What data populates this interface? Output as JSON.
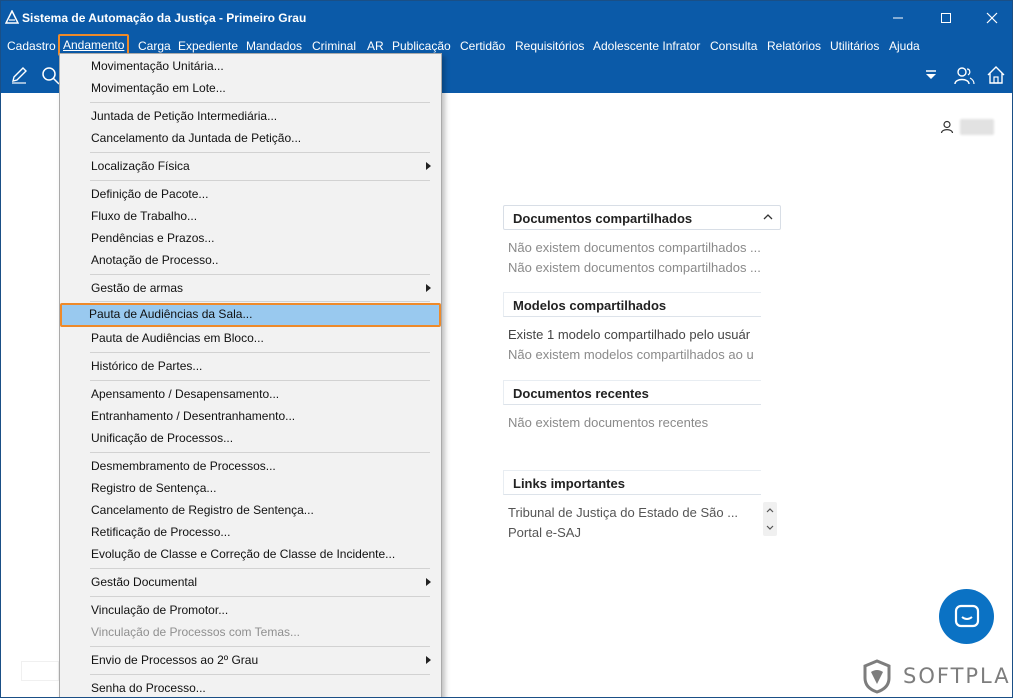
{
  "window": {
    "title": "Sistema de Automação da Justiça - Primeiro Grau"
  },
  "menubar": {
    "items": [
      "Cadastro",
      "Andamento",
      "Carga",
      "Expediente",
      "Mandados",
      "Criminal",
      "AR",
      "Publicação",
      "Certidão",
      "Requisitórios",
      "Adolescente Infrator",
      "Consulta",
      "Relatórios",
      "Utilitários",
      "Ajuda"
    ]
  },
  "dropdown": {
    "items": [
      {
        "label": "Movimentação Unitária..."
      },
      {
        "label": "Movimentação em Lote..."
      },
      {
        "label": "Juntada de Petição Intermediária..."
      },
      {
        "label": "Cancelamento da Juntada de Petição..."
      },
      {
        "label": "Localização Física"
      },
      {
        "label": "Definição de Pacote..."
      },
      {
        "label": "Fluxo de Trabalho..."
      },
      {
        "label": "Pendências e Prazos..."
      },
      {
        "label": "Anotação de Processo.."
      },
      {
        "label": "Gestão de armas"
      },
      {
        "label": "Pauta de Audiências da Sala..."
      },
      {
        "label": "Pauta de Audiências em Bloco..."
      },
      {
        "label": "Histórico de Partes..."
      },
      {
        "label": "Apensamento / Desapensamento..."
      },
      {
        "label": "Entranhamento / Desentranhamento..."
      },
      {
        "label": "Unificação de Processos..."
      },
      {
        "label": "Desmembramento de Processos..."
      },
      {
        "label": "Registro de Sentença..."
      },
      {
        "label": "Cancelamento de Registro de Sentença..."
      },
      {
        "label": "Retificação de Processo..."
      },
      {
        "label": "Evolução de Classe e Correção de Classe de Incidente..."
      },
      {
        "label": "Gestão Documental"
      },
      {
        "label": "Vinculação de Promotor..."
      },
      {
        "label": "Vinculação de Processos com Temas..."
      },
      {
        "label": "Envio de Processos ao 2º Grau"
      },
      {
        "label": "Senha do Processo..."
      }
    ]
  },
  "panels": {
    "shared_docs": {
      "title": "Documentos compartilhados",
      "lines": [
        "Não existem documentos compartilhados ...",
        "Não existem documentos compartilhados ..."
      ]
    },
    "shared_models": {
      "title": "Modelos compartilhados",
      "lines": [
        "Existe 1 modelo compartilhado pelo usuár",
        "Não existem modelos compartilhados ao u"
      ]
    },
    "recent_docs": {
      "title": "Documentos recentes",
      "lines": [
        "Não existem documentos recentes"
      ]
    },
    "links": {
      "title": "Links importantes",
      "lines": [
        "Tribunal de Justiça do Estado de São ...",
        "Portal e-SAJ"
      ]
    }
  },
  "brand": {
    "name": "SOFTPLAN"
  },
  "colors": {
    "titlebar": "#0b5aa8",
    "highlight": "#99c9ef",
    "focus_outline": "#ee8a2a",
    "chat_button": "#0b72c4"
  }
}
